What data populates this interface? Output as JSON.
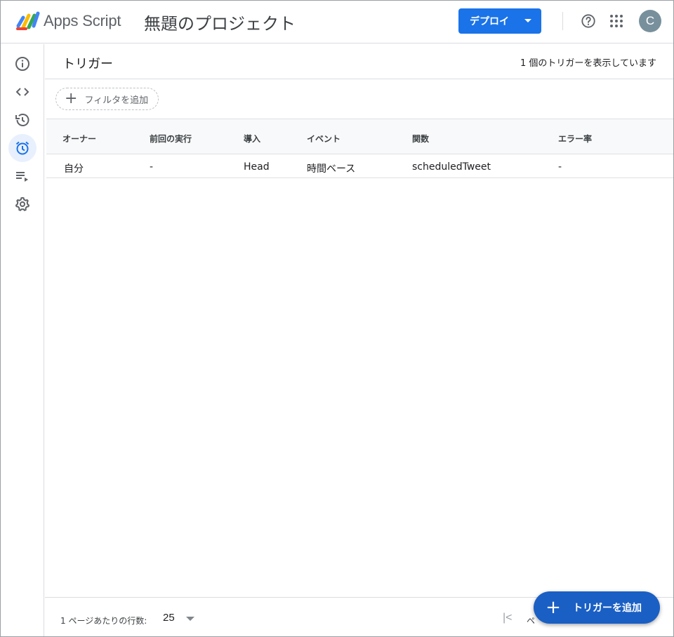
{
  "header": {
    "brand": "Apps Script",
    "project_title": "無題のプロジェクト",
    "deploy_label": "デプロイ",
    "avatar_initial": "C"
  },
  "sidebar": {
    "items": [
      {
        "name": "overview",
        "icon": "info-icon"
      },
      {
        "name": "editor",
        "icon": "code-icon"
      },
      {
        "name": "history",
        "icon": "history-icon"
      },
      {
        "name": "triggers",
        "icon": "alarm-clock-icon",
        "active": true
      },
      {
        "name": "executions",
        "icon": "playlist-play-icon"
      },
      {
        "name": "settings",
        "icon": "gear-icon"
      }
    ]
  },
  "main": {
    "title": "トリガー",
    "count_text": "1 個のトリガーを表示しています",
    "filter_label": "フィルタを追加",
    "columns": [
      "オーナー",
      "前回の実行",
      "導入",
      "イベント",
      "関数",
      "エラー率"
    ],
    "rows": [
      [
        "自分",
        "-",
        "Head",
        "時間ベース",
        "scheduledTweet",
        "-"
      ]
    ]
  },
  "footer": {
    "rows_per_page_label": "1 ページあたりの行数:",
    "rows_per_page_value": "25",
    "page_label": "ペ"
  },
  "fab": {
    "label": "トリガーを追加"
  },
  "colors": {
    "accent": "#1a73e8",
    "fab": "#1a5fc4",
    "active_bg": "#e8f0fe"
  }
}
